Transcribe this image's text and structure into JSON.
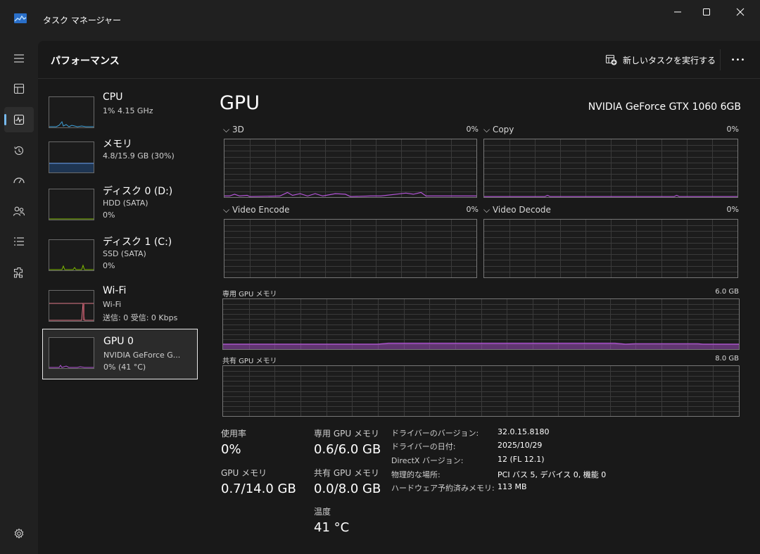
{
  "window": {
    "title": "タスク マネージャー"
  },
  "header": {
    "page_title": "パフォーマンス",
    "run_task_label": "新しいタスクを実行する",
    "more_label": "•••"
  },
  "devices": [
    {
      "name": "CPU",
      "line1": "1%  4.15 GHz",
      "line2": "",
      "accent": "#3ea0d8"
    },
    {
      "name": "メモリ",
      "line1": "4.8/15.9 GB (30%)",
      "line2": "",
      "accent": "#5d8ed4"
    },
    {
      "name": "ディスク 0 (D:)",
      "line1": "HDD (SATA)",
      "line2": "0%",
      "accent": "#7fba00"
    },
    {
      "name": "ディスク 1 (C:)",
      "line1": "SSD (SATA)",
      "line2": "0%",
      "accent": "#7fba00"
    },
    {
      "name": "Wi-Fi",
      "line1": "Wi-Fi",
      "line2": "送信: 0 受信: 0 Kbps",
      "accent": "#e07a8a"
    },
    {
      "name": "GPU 0",
      "line1": "NVIDIA GeForce G...",
      "line2": "0% (41 °C)",
      "accent": "#b455d8"
    }
  ],
  "gpu": {
    "title": "GPU",
    "model": "NVIDIA GeForce GTX 1060 6GB",
    "accent": "#b455d8",
    "engines": [
      {
        "label": "3D",
        "percent": "0%"
      },
      {
        "label": "Copy",
        "percent": "0%"
      },
      {
        "label": "Video Encode",
        "percent": "0%"
      },
      {
        "label": "Video Decode",
        "percent": "0%"
      }
    ],
    "dedicated_memory": {
      "label": "専用 GPU メモリ",
      "max": "6.0 GB"
    },
    "shared_memory": {
      "label": "共有 GPU メモリ",
      "max": "8.0 GB"
    },
    "stats": {
      "utilization_label": "使用率",
      "utilization_value": "0%",
      "dedicated_label": "専用 GPU メモリ",
      "dedicated_value": "0.6/6.0 GB",
      "gpu_memory_label": "GPU メモリ",
      "gpu_memory_value": "0.7/14.0 GB",
      "shared_label": "共有 GPU メモリ",
      "shared_value": "0.0/8.0 GB",
      "temp_label": "温度",
      "temp_value": "41 °C"
    },
    "info": [
      {
        "key": "ドライバーのバージョン:",
        "value": "32.0.15.8180"
      },
      {
        "key": "ドライバーの日付:",
        "value": "2025/10/29"
      },
      {
        "key": "DirectX バージョン:",
        "value": "12 (FL 12.1)"
      },
      {
        "key": "物理的な場所:",
        "value": "PCI バス 5, デバイス 0, 機能 0"
      },
      {
        "key": "ハードウェア予約済みメモリ:",
        "value": "113 MB"
      }
    ]
  },
  "icons": {
    "rail": [
      "hamburger-icon",
      "processes-icon",
      "performance-icon",
      "app-history-icon",
      "startup-apps-icon",
      "users-icon",
      "details-icon",
      "services-icon",
      "settings-icon"
    ]
  }
}
